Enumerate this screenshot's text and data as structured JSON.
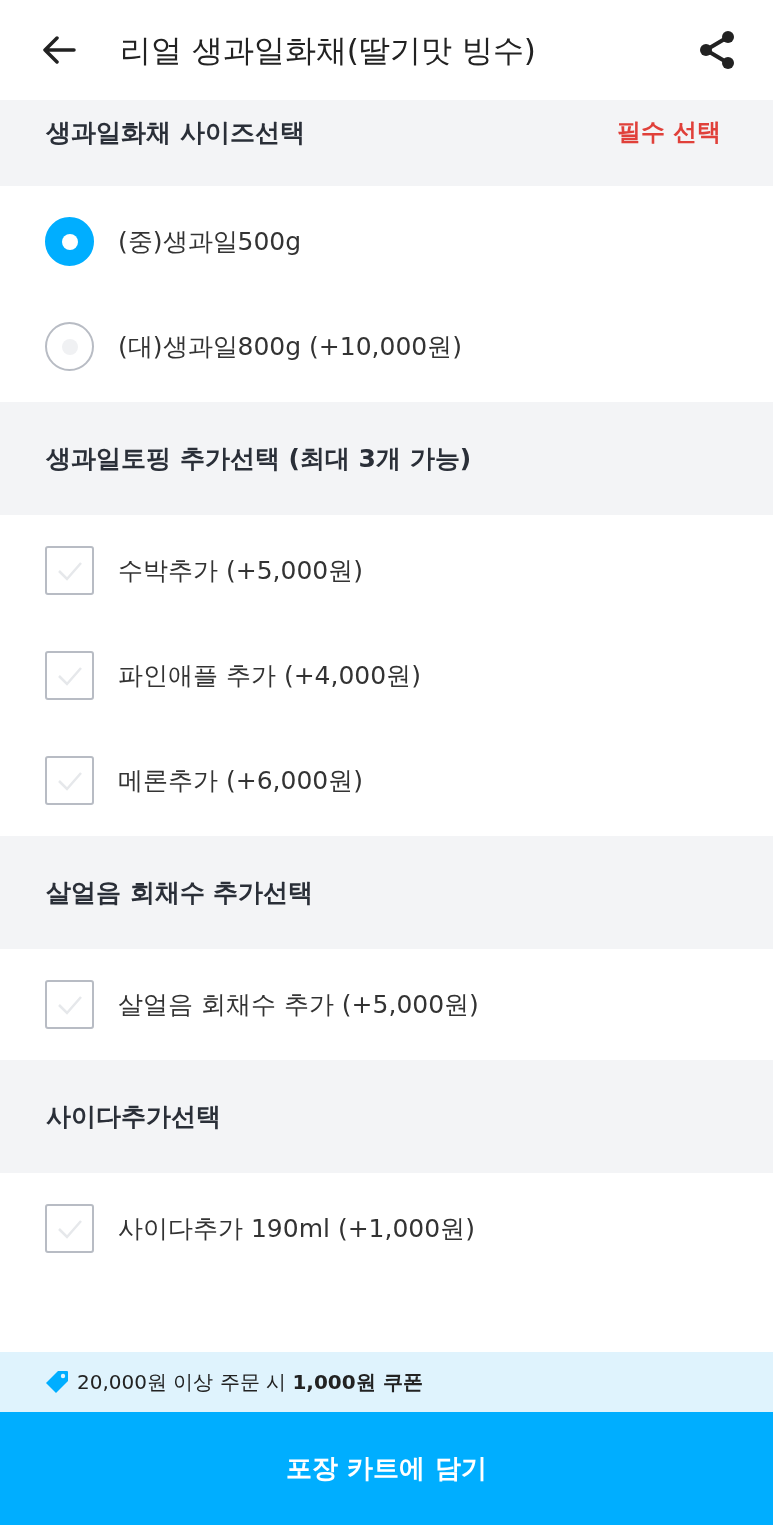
{
  "header": {
    "title": "리얼 생과일화채(딸기맛 빙수)"
  },
  "sections": [
    {
      "title": "생과일화채 사이즈선택",
      "badge": "필수 선택",
      "kind": "radio",
      "options": [
        {
          "label": "(중)생과일500g",
          "selected": true
        },
        {
          "label": "(대)생과일800g (+10,000원)",
          "selected": false
        }
      ]
    },
    {
      "title": "생과일토핑 추가선택 (최대 3개 가능)",
      "kind": "checkbox",
      "options": [
        {
          "label": "수박추가 (+5,000원)",
          "checked": false
        },
        {
          "label": "파인애플 추가 (+4,000원)",
          "checked": false
        },
        {
          "label": "메론추가 (+6,000원)",
          "checked": false
        }
      ]
    },
    {
      "title": "살얼음 회채수 추가선택",
      "kind": "checkbox",
      "options": [
        {
          "label": "살얼음 회채수 추가 (+5,000원)",
          "checked": false
        }
      ]
    },
    {
      "title": "사이다추가선택",
      "kind": "checkbox",
      "options": [
        {
          "label": "사이다추가 190ml (+1,000원)",
          "checked": false
        }
      ]
    }
  ],
  "coupon": "20,000원 이상 주문 시 **1,000원 쿠폰**",
  "cart_button": "포장 카트에 담기"
}
